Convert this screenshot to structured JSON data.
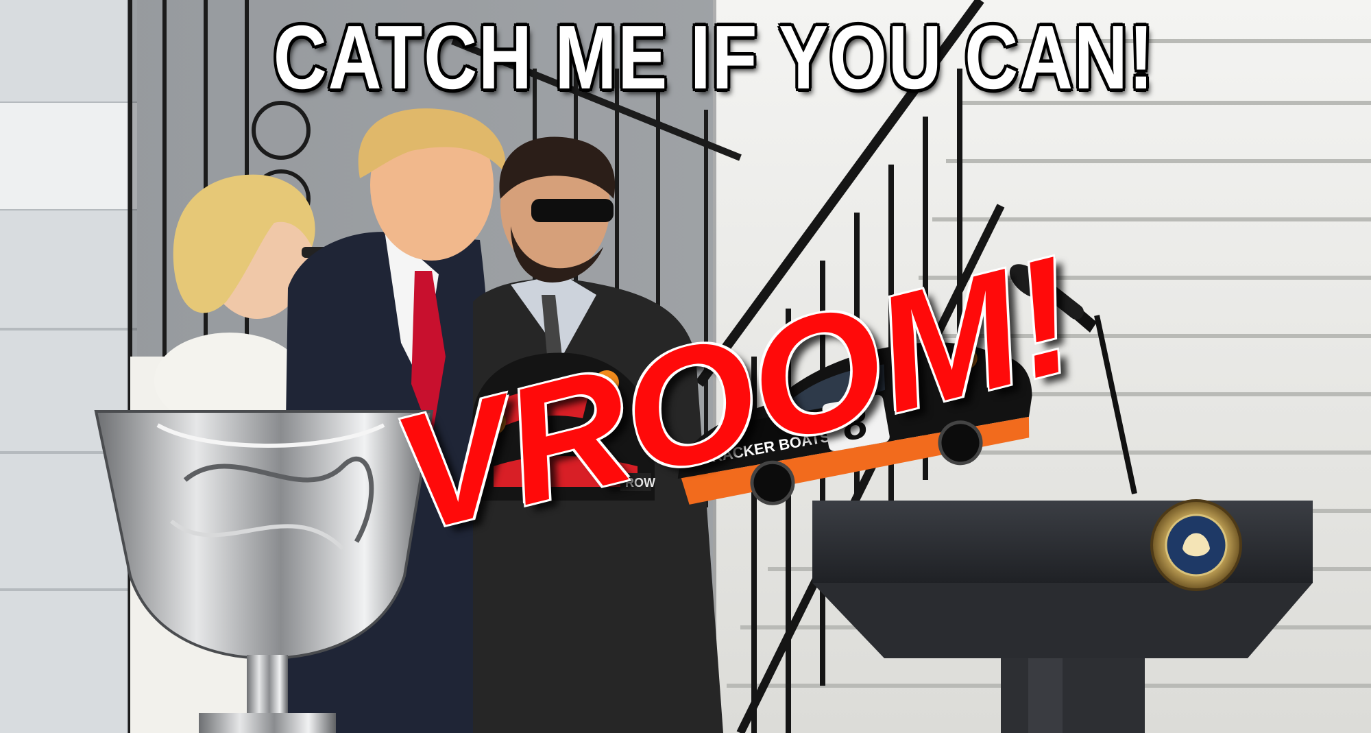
{
  "meme": {
    "top_caption": "CATCH ME IF YOU CAN!",
    "overlay_caption": "VROOM!"
  },
  "scene": {
    "car_number": "8",
    "car_sponsor": "TRACKER BOATS",
    "helmet_text": "ROW"
  },
  "colors": {
    "caption_fill": "#ffffff",
    "caption_outline": "#000000",
    "vroom_fill": "#ff0a0a",
    "tie": "#c8102e",
    "car_orange": "#f26b1d"
  },
  "icons": [
    "presidential-seal-icon",
    "microphone-icon",
    "trophy-icon",
    "race-car-icon",
    "helmet-icon"
  ]
}
